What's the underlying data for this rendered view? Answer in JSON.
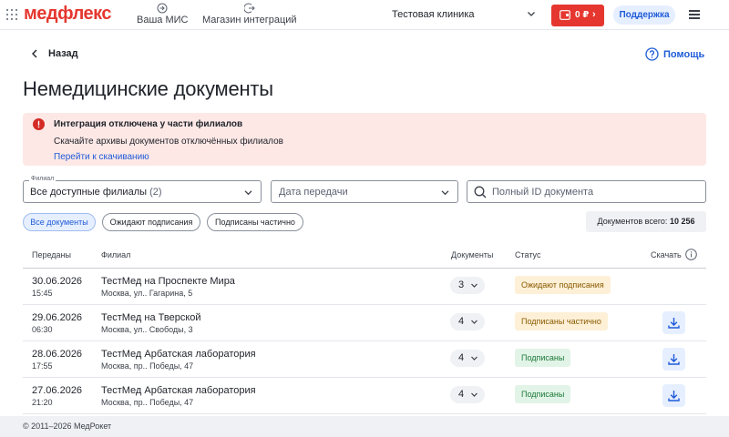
{
  "header": {
    "logo": "медфлекс",
    "nav": [
      {
        "label": "Ваша МИС",
        "icon": "login-arrow-icon"
      },
      {
        "label": "Магазин интеграций",
        "icon": "logout-arrow-icon"
      }
    ],
    "clinic": "Тестовая клиника",
    "balance": "0 ₽",
    "balance_arrow": "›",
    "support": "Поддержка"
  },
  "page": {
    "back": "Назад",
    "help": "Помощь",
    "title": "Немедицинские документы"
  },
  "alert": {
    "title": "Интеграция отключена у части филиалов",
    "text": "Скачайте архивы документов отключённых филиалов",
    "link": "Перейти к скачиванию",
    "color": "#fde8e6"
  },
  "filters": {
    "branch_label": "Филиал",
    "branch_value": "Все доступные филиалы",
    "branch_count": "(2)",
    "date_placeholder": "Дата передачи",
    "search_placeholder": "Полный ID документа"
  },
  "chips": [
    {
      "label": "Все документы",
      "active": true
    },
    {
      "label": "Ожидают подписания",
      "active": false
    },
    {
      "label": "Подписаны частично",
      "active": false
    }
  ],
  "total": {
    "label": "Документов всего:",
    "value": "10 256"
  },
  "table": {
    "columns": [
      "Переданы",
      "Филиал",
      "Документы",
      "Статус",
      "Скачать"
    ],
    "rows": [
      {
        "date": "30.06.2026",
        "time": "15:45",
        "branch": "ТестМед на Проспекте Мира",
        "address": "Москва, ул.. Гагарина, 5",
        "docs": "3",
        "status": "Ожидают подписания",
        "status_type": "waiting",
        "download": false
      },
      {
        "date": "29.06.2026",
        "time": "06:30",
        "branch": "ТестМед на Тверской",
        "address": "Москва, ул.. Свободы, 3",
        "docs": "4",
        "status": "Подписаны частично",
        "status_type": "partial",
        "download": true
      },
      {
        "date": "28.06.2026",
        "time": "17:55",
        "branch": "ТестМед Арбатская лаборатория",
        "address": "Москва, пр.. Победы, 47",
        "docs": "4",
        "status": "Подписаны",
        "status_type": "signed",
        "download": true
      },
      {
        "date": "27.06.2026",
        "time": "21:20",
        "branch": "ТестМед Арбатская лаборатория",
        "address": "Москва, пр.. Победы, 47",
        "docs": "4",
        "status": "Подписаны",
        "status_type": "signed",
        "download": true
      }
    ]
  },
  "footer": "© 2011–2026 МедРокет",
  "colors": {
    "brand": "#e5372f",
    "accent": "#1f5bd8",
    "waiting": "#fdf0d7",
    "signed": "#e2f4e7"
  }
}
